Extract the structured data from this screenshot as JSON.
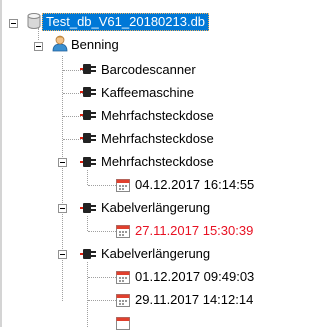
{
  "tree": {
    "root": {
      "label": "Test_db_V61_20180213.db",
      "icon": "database-icon",
      "expanded": true,
      "selected": true
    },
    "user": {
      "label": "Benning",
      "icon": "user-icon",
      "expanded": true
    },
    "devices": [
      {
        "label": "Barcodescanner",
        "icon": "plug-icon"
      },
      {
        "label": "Kaffeemaschine",
        "icon": "plug-icon"
      },
      {
        "label": "Mehrfachsteckdose",
        "icon": "plug-icon"
      },
      {
        "label": "Mehrfachsteckdose",
        "icon": "plug-icon"
      },
      {
        "label": "Mehrfachsteckdose",
        "icon": "plug-icon",
        "expanded": true,
        "tests": [
          {
            "label": "04.12.2017 16:14:55",
            "icon": "calendar-icon"
          }
        ]
      },
      {
        "label": "Kabelverlängerung",
        "icon": "plug-icon",
        "expanded": true,
        "tests": [
          {
            "label": "27.11.2017 15:30:39",
            "icon": "calendar-icon",
            "color": "#e81123"
          }
        ]
      },
      {
        "label": "Kabelverlängerung",
        "icon": "plug-icon",
        "expanded": true,
        "tests": [
          {
            "label": "01.12.2017 09:49:03",
            "icon": "calendar-icon"
          },
          {
            "label": "29.11.2017 14:12:14",
            "icon": "calendar-icon"
          }
        ]
      }
    ]
  },
  "colors": {
    "selection": "#0078d7",
    "failed_text": "#e81123",
    "tree_lines": "#a0a0a0"
  }
}
